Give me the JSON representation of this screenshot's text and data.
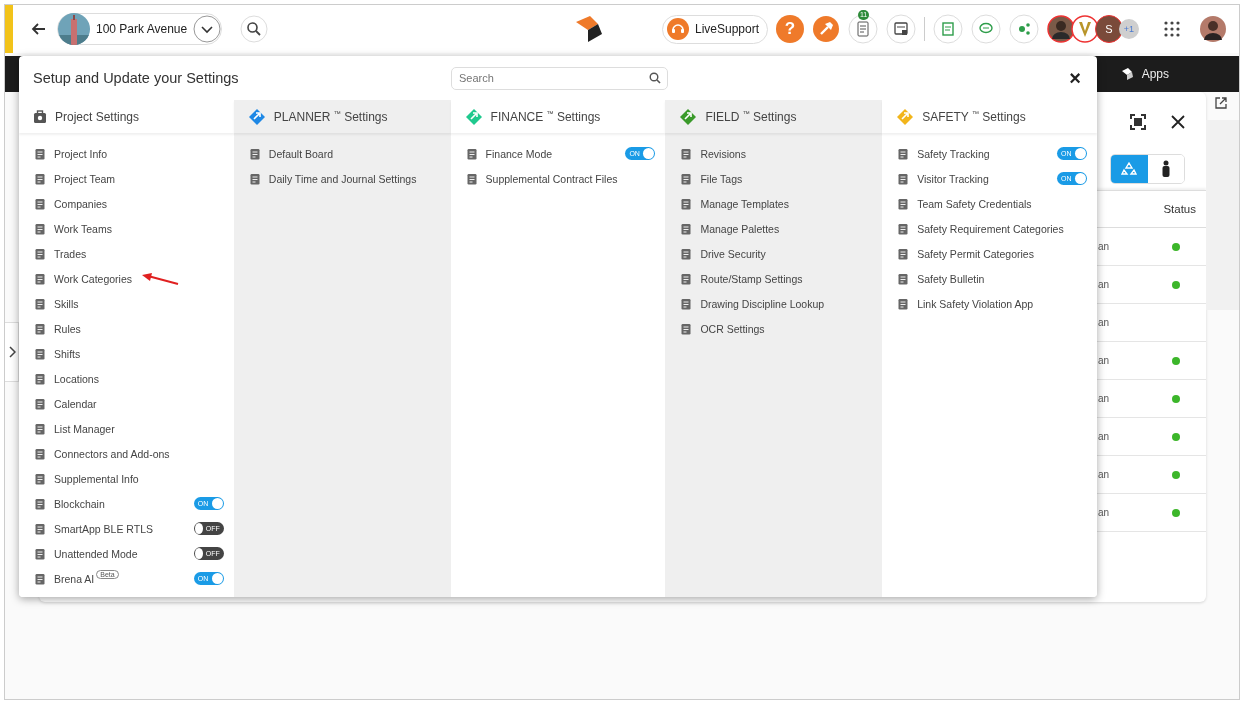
{
  "topbar": {
    "project_name": "100 Park Avenue",
    "live_support": "LiveSupport",
    "help": "?",
    "notification_count": "11",
    "avatar_initial": "S",
    "more_avatars": "+1"
  },
  "appbar": {
    "apps_label": "Apps"
  },
  "modal": {
    "title": "Setup and Update your Settings",
    "search": {
      "placeholder": "Search"
    },
    "close": "×",
    "columns": [
      {
        "title": "Project Settings",
        "color": "#555555",
        "items": [
          {
            "label": "Project Info",
            "kind": "link",
            "pointed": false
          },
          {
            "label": "Project Team",
            "kind": "link",
            "pointed": false
          },
          {
            "label": "Companies",
            "kind": "link",
            "pointed": false
          },
          {
            "label": "Work Teams",
            "kind": "link",
            "pointed": false
          },
          {
            "label": "Trades",
            "kind": "link",
            "pointed": false
          },
          {
            "label": "Work Categories",
            "kind": "link",
            "pointed": true
          },
          {
            "label": "Skills",
            "kind": "link",
            "pointed": false
          },
          {
            "label": "Rules",
            "kind": "link",
            "pointed": false
          },
          {
            "label": "Shifts",
            "kind": "link",
            "pointed": false
          },
          {
            "label": "Locations",
            "kind": "link",
            "pointed": false
          },
          {
            "label": "Calendar",
            "kind": "link",
            "pointed": false
          },
          {
            "label": "List Manager",
            "kind": "link",
            "pointed": false
          },
          {
            "label": "Connectors and Add-ons",
            "kind": "link",
            "pointed": false
          },
          {
            "label": "Supplemental Info",
            "kind": "link",
            "pointed": false
          },
          {
            "label": "Blockchain",
            "kind": "toggle",
            "on": true,
            "toggle_label": "ON",
            "pointed": false
          },
          {
            "label": "SmartApp BLE RTLS",
            "kind": "toggle",
            "on": false,
            "toggle_label": "OFF",
            "pointed": false
          },
          {
            "label": "Unattended Mode",
            "kind": "toggle",
            "on": false,
            "toggle_label": "OFF",
            "pointed": false
          },
          {
            "label": "Brena AI",
            "kind": "toggle",
            "on": true,
            "toggle_label": "ON",
            "badge": "Beta",
            "pointed": false
          }
        ]
      },
      {
        "title": "PLANNER $^{™}$ Settings",
        "color": "#1e88e5",
        "items": [
          {
            "label": "Default Board",
            "kind": "link",
            "pointed": false
          },
          {
            "label": "Daily Time and Journal Settings",
            "kind": "link",
            "pointed": false
          }
        ]
      },
      {
        "title": "FINANCE $^{™}$ Settings",
        "color": "#1fc98e",
        "items": [
          {
            "label": "Finance Mode",
            "kind": "toggle",
            "on": true,
            "toggle_label": "ON",
            "pointed": false
          },
          {
            "label": "Supplemental Contract Files",
            "kind": "link",
            "pointed": false
          }
        ]
      },
      {
        "title": "FIELD $^{™}$ Settings",
        "color": "#3a9a2a",
        "items": [
          {
            "label": "Revisions",
            "kind": "link",
            "pointed": false
          },
          {
            "label": "File Tags",
            "kind": "link",
            "pointed": false
          },
          {
            "label": "Manage Templates",
            "kind": "link",
            "pointed": false
          },
          {
            "label": "Manage Palettes",
            "kind": "link",
            "pointed": false
          },
          {
            "label": "Drive Security",
            "kind": "link",
            "pointed": false
          },
          {
            "label": "Route/Stamp Settings",
            "kind": "link",
            "pointed": false
          },
          {
            "label": "Drawing Discipline Lookup",
            "kind": "link",
            "pointed": false
          },
          {
            "label": "OCR Settings",
            "kind": "link",
            "pointed": false
          }
        ]
      },
      {
        "title": "SAFETY $^{™}$ Settings",
        "color": "#f2b51b",
        "items": [
          {
            "label": "Safety Tracking",
            "kind": "toggle",
            "on": true,
            "toggle_label": "ON",
            "pointed": false
          },
          {
            "label": "Visitor Tracking",
            "kind": "toggle",
            "on": true,
            "toggle_label": "ON",
            "pointed": false
          },
          {
            "label": "Team Safety Credentials",
            "kind": "link",
            "pointed": false
          },
          {
            "label": "Safety Requirement Categories",
            "kind": "link",
            "pointed": false
          },
          {
            "label": "Safety Permit Categories",
            "kind": "link",
            "pointed": false
          },
          {
            "label": "Safety Bulletin",
            "kind": "link",
            "pointed": false
          },
          {
            "label": "Link Safety Violation App",
            "kind": "link",
            "pointed": false
          }
        ]
      }
    ]
  },
  "panel": {
    "view_toggle": [
      {
        "selected": true
      },
      {
        "selected": false
      }
    ],
    "status_header": "Status",
    "rows": [
      {
        "cell": "an",
        "active": true
      },
      {
        "cell": "an",
        "active": true
      },
      {
        "cell": "an",
        "active": false
      },
      {
        "cell": "an",
        "active": true
      },
      {
        "cell": "an",
        "active": true
      },
      {
        "cell": "an",
        "active": true
      },
      {
        "cell": "an",
        "active": true
      },
      {
        "cell": "an",
        "active": true
      }
    ]
  }
}
